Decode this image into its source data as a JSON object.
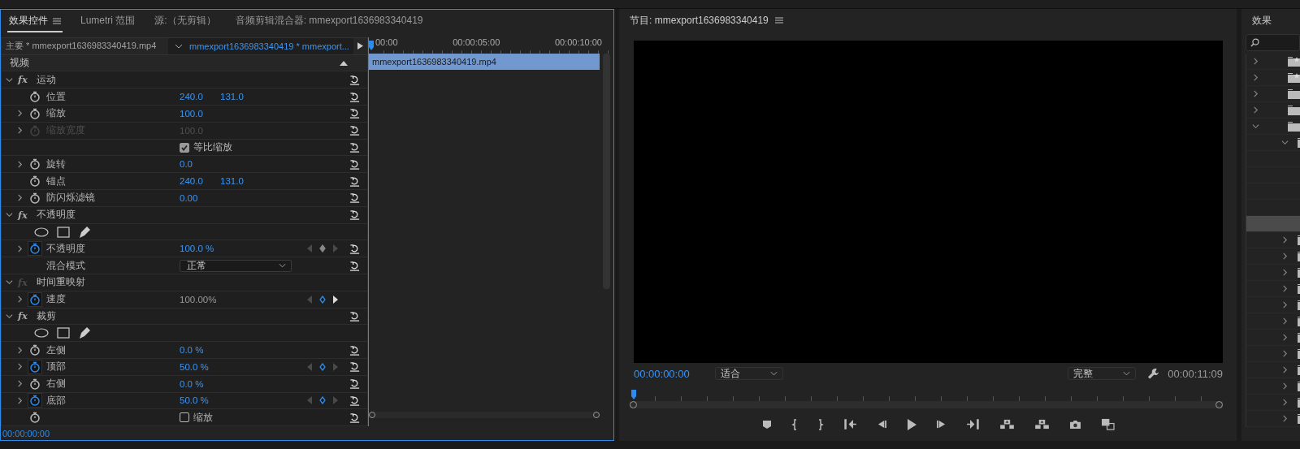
{
  "panel_tabs": [
    {
      "label": "效果控件",
      "selected": true,
      "menu": true
    },
    {
      "label": "Lumetri 范围",
      "selected": false,
      "menu": false
    },
    {
      "label": "源:（无剪辑）",
      "selected": false,
      "menu": false
    },
    {
      "label": "音频剪辑混合器: mmexport1636983340419",
      "selected": false,
      "menu": false
    }
  ],
  "clip_header": {
    "master": "主要 * mmexport1636983340419.mp4",
    "clip": "mmexport1636983340419 * mmexport..."
  },
  "rows": [
    {
      "kind": "section",
      "label": "视频",
      "expanded": true,
      "resettable": false
    },
    {
      "kind": "effect",
      "label": "运动",
      "badge": "fx",
      "expanded": true,
      "fx_enabled": true,
      "resettable": true
    },
    {
      "kind": "param",
      "label": "位置",
      "values": [
        "240.0",
        "131.0"
      ],
      "disabled": false,
      "readonly": false,
      "animated": false,
      "resettable": true
    },
    {
      "kind": "param",
      "label": "缩放",
      "expanded": false,
      "values": [
        "100.0"
      ],
      "disabled": false,
      "readonly": false,
      "animated": false,
      "resettable": true
    },
    {
      "kind": "param",
      "label": "缩放宽度",
      "expanded": false,
      "values": [
        "100.0"
      ],
      "disabled": true,
      "readonly": false,
      "animated": false,
      "resettable": true
    },
    {
      "kind": "checkbox",
      "label": "等比缩放",
      "checked": true,
      "stopwatch": false,
      "resettable": true
    },
    {
      "kind": "param",
      "label": "旋转",
      "expanded": false,
      "values": [
        "0.0"
      ],
      "disabled": false,
      "readonly": false,
      "animated": false,
      "resettable": true
    },
    {
      "kind": "param",
      "label": "锚点",
      "values": [
        "240.0",
        "131.0"
      ],
      "disabled": false,
      "readonly": false,
      "animated": false,
      "resettable": true
    },
    {
      "kind": "param",
      "label": "防闪烁滤镜",
      "expanded": false,
      "values": [
        "0.00"
      ],
      "disabled": false,
      "readonly": false,
      "animated": false,
      "resettable": true
    },
    {
      "kind": "effect",
      "label": "不透明度",
      "badge": "fx",
      "expanded": true,
      "fx_enabled": true,
      "resettable": true
    },
    {
      "kind": "masks",
      "resettable": false
    },
    {
      "kind": "param",
      "label": "不透明度",
      "expanded": false,
      "values": [
        "100.0 %"
      ],
      "disabled": false,
      "readonly": false,
      "animated": true,
      "at_keyframe": false,
      "next_keyframe": false,
      "resettable": true
    },
    {
      "kind": "dropdown",
      "label": "混合模式",
      "value": "正常",
      "resettable": true
    },
    {
      "kind": "effect",
      "label": "时间重映射",
      "badge": "fx",
      "expanded": true,
      "fx_enabled": false,
      "resettable": false
    },
    {
      "kind": "param",
      "label": "速度",
      "expanded": false,
      "values": [
        "100.00%"
      ],
      "disabled": false,
      "readonly": true,
      "animated": true,
      "at_keyframe": true,
      "next_keyframe": true,
      "resettable": false
    },
    {
      "kind": "effect",
      "label": "裁剪",
      "badge": "fx",
      "expanded": true,
      "fx_enabled": true,
      "resettable": true
    },
    {
      "kind": "masks",
      "resettable": false
    },
    {
      "kind": "param",
      "label": "左侧",
      "expanded": false,
      "values": [
        "0.0 %"
      ],
      "disabled": false,
      "readonly": false,
      "animated": false,
      "resettable": true
    },
    {
      "kind": "param",
      "label": "顶部",
      "expanded": false,
      "values": [
        "50.0 %"
      ],
      "disabled": false,
      "readonly": false,
      "animated": true,
      "at_keyframe": true,
      "next_keyframe": false,
      "resettable": true
    },
    {
      "kind": "param",
      "label": "右侧",
      "expanded": false,
      "values": [
        "0.0 %"
      ],
      "disabled": false,
      "readonly": false,
      "animated": false,
      "resettable": true
    },
    {
      "kind": "param",
      "label": "底部",
      "expanded": false,
      "values": [
        "50.0 %"
      ],
      "disabled": false,
      "readonly": false,
      "animated": true,
      "at_keyframe": true,
      "next_keyframe": false,
      "resettable": true
    },
    {
      "kind": "checkbox",
      "label": "缩放",
      "checked": false,
      "stopwatch": true,
      "resettable": true
    }
  ],
  "timeline": {
    "ticks": [
      "00:00",
      "00:00:05:00",
      "00:00:10:00"
    ],
    "clip": "mmexport1636983340419.mp4"
  },
  "current_time": "00:00:00:00",
  "program": {
    "title": "节目: mmexport1636983340419",
    "timecode": "00:00:00:00",
    "zoom": "适合",
    "quality": "完整",
    "duration": "00:00:11:09"
  },
  "effects_panel": {
    "title": "效果"
  },
  "effects_tree": [
    {
      "kind": "starred_folder",
      "expanded": false,
      "selected": false
    },
    {
      "kind": "starred_folder",
      "expanded": false,
      "selected": false
    },
    {
      "kind": "folder",
      "expanded": false,
      "selected": false
    },
    {
      "kind": "folder",
      "expanded": false,
      "selected": false
    },
    {
      "kind": "folder",
      "expanded": true,
      "selected": false,
      "children": [
        {
          "expanded": true,
          "selected": false,
          "children": [
            {
              "selected": false
            },
            {
              "selected": false
            },
            {
              "selected": false
            },
            {
              "selected": false
            },
            {
              "selected": true
            }
          ]
        },
        {
          "expanded": false,
          "selected": false
        },
        {
          "expanded": false,
          "selected": false
        },
        {
          "expanded": false,
          "selected": false
        },
        {
          "expanded": false,
          "selected": false
        },
        {
          "expanded": false,
          "selected": false
        },
        {
          "expanded": false,
          "selected": false
        },
        {
          "expanded": false,
          "selected": false
        },
        {
          "expanded": false,
          "selected": false
        },
        {
          "expanded": false,
          "selected": false
        },
        {
          "expanded": false,
          "selected": false
        },
        {
          "expanded": false,
          "selected": false
        },
        {
          "expanded": false,
          "selected": false
        }
      ]
    }
  ]
}
